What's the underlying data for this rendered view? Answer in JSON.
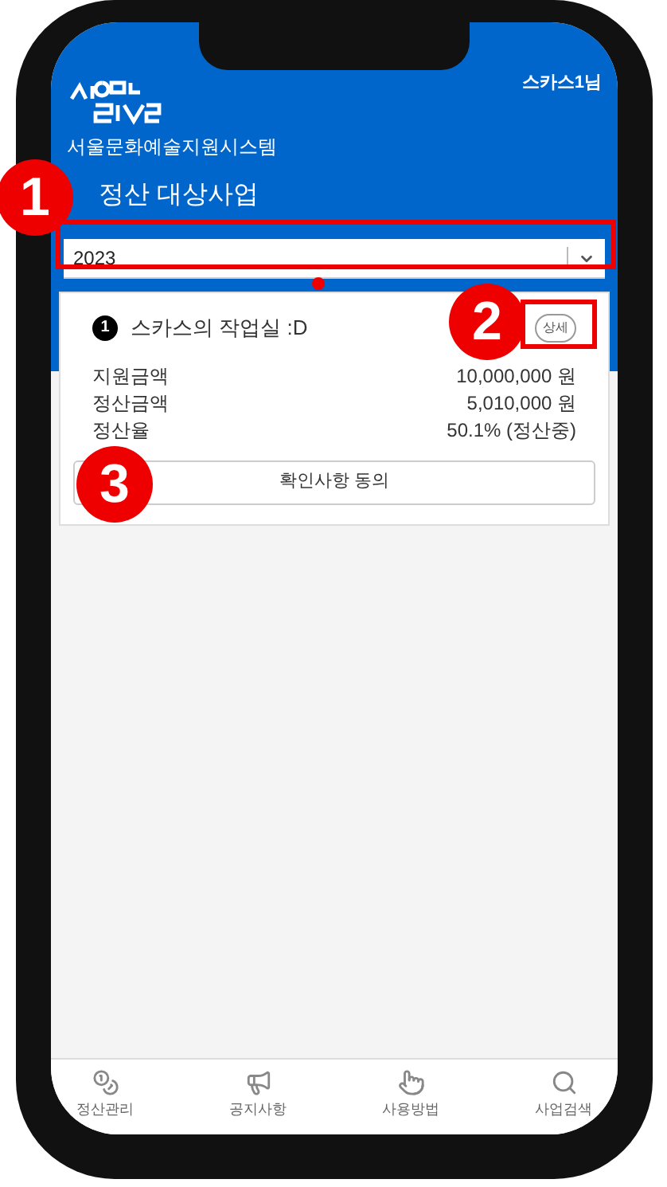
{
  "header": {
    "subtitle": "서울문화예술지원시스템",
    "user": "스카스1님",
    "title": "정산 대상사업"
  },
  "year_select": {
    "value": "2023"
  },
  "projects": [
    {
      "number": "1",
      "name": "스카스의 작업실 :D",
      "detail_button": "상세",
      "rows": [
        {
          "label": "지원금액",
          "value": "10,000,000 원"
        },
        {
          "label": "정산금액",
          "value": "5,010,000 원"
        },
        {
          "label": "정산율",
          "value": "50.1% (정산중)"
        }
      ],
      "action_button": "확인사항 동의"
    }
  ],
  "bottom_nav": [
    {
      "kind": "coins",
      "label": "정산관리"
    },
    {
      "kind": "megaphone",
      "label": "공지사항"
    },
    {
      "kind": "touch",
      "label": "사용방법"
    },
    {
      "kind": "search",
      "label": "사업검색"
    }
  ],
  "callouts": [
    {
      "label": "1"
    },
    {
      "label": "2"
    },
    {
      "label": "3"
    }
  ]
}
